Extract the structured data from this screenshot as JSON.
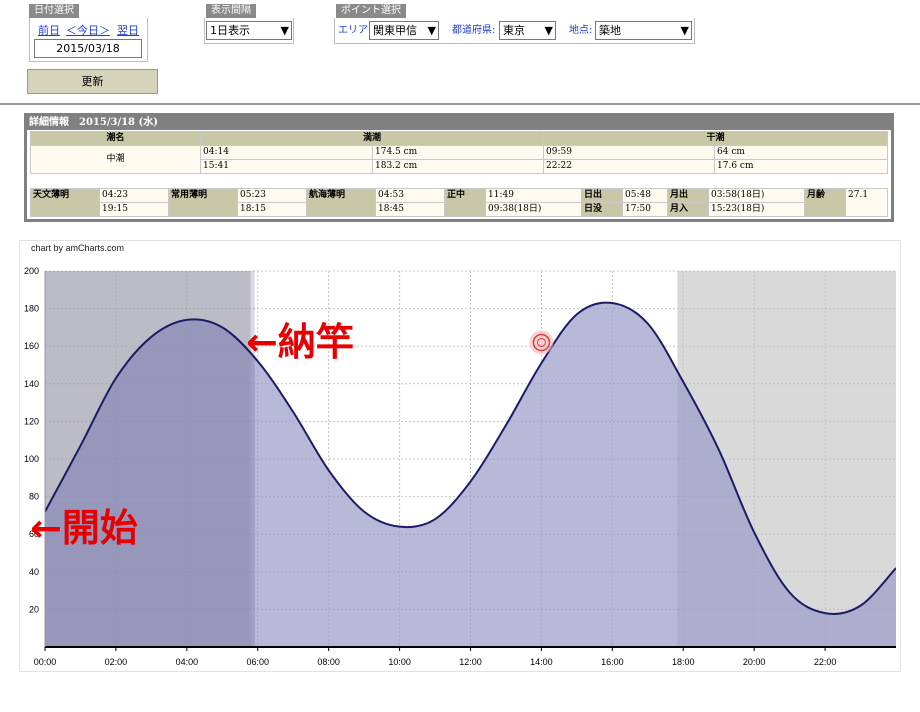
{
  "date_group": {
    "label": "日付選択",
    "prev": "前日",
    "today": "＜今日＞",
    "next": "翌日",
    "date": "2015/03/18",
    "update_button": "更新"
  },
  "interval_group": {
    "label": "表示間隔",
    "value": "1日表示"
  },
  "point_group": {
    "label": "ポイント選択",
    "area_label": "エリア:",
    "area_value": "関東甲信",
    "pref_label": "都道府県:",
    "pref_value": "東京",
    "site_label": "地点:",
    "site_value": "築地"
  },
  "detail": {
    "title": "詳細情報　2015/3/18 (水)",
    "headers": {
      "tide_name": "潮名",
      "high_tide": "満潮",
      "low_tide": "干潮"
    },
    "tide_name": "中潮",
    "high": [
      {
        "time": "04:14",
        "level": "174.5 cm"
      },
      {
        "time": "15:41",
        "level": "183.2 cm"
      }
    ],
    "low": [
      {
        "time": "09:59",
        "level": "64 cm"
      },
      {
        "time": "22:22",
        "level": "17.6 cm"
      }
    ],
    "twilight": {
      "astro_label": "天文薄明",
      "astro": [
        "04:23",
        "19:15"
      ],
      "civil_label": "常用薄明",
      "civil": [
        "05:23",
        "18:15"
      ],
      "nautical_label": "航海薄明",
      "nautical": [
        "04:53",
        "18:45"
      ],
      "noon_label": "正中",
      "noon": [
        "11:49",
        "09:38(18日)"
      ],
      "sunrise_label": "日出",
      "sunrise": "05:48",
      "sunset_label": "日没",
      "sunset": "17:50",
      "moonrise_label": "月出",
      "moonrise": "03:58(18日)",
      "moonset_label": "月入",
      "moonset": "15:23(18日)",
      "moonage_label": "月齢",
      "moonage": "27.1"
    }
  },
  "chart_credit": "chart by amCharts.com",
  "annotations": {
    "start": "←開始",
    "end": "←納竿"
  },
  "colors": {
    "line": "#1c1c66",
    "fill": "#9a9ac8",
    "night": "#d9d9d9",
    "accent": "#e60000"
  },
  "chart_data": {
    "type": "area",
    "xlabel": "",
    "ylabel": "",
    "x_ticks": [
      "00:00",
      "02:00",
      "04:00",
      "06:00",
      "08:00",
      "10:00",
      "12:00",
      "14:00",
      "16:00",
      "18:00",
      "20:00",
      "22:00"
    ],
    "y_ticks": [
      "20",
      "40",
      "60",
      "80",
      "100",
      "120",
      "140",
      "160",
      "180",
      "200"
    ],
    "ylim": [
      0,
      200
    ],
    "xlim_hours": [
      0,
      24
    ],
    "series": [
      {
        "values_hourly": [
          72,
          107,
          143,
          165,
          174,
          170,
          152,
          125,
          94,
          72,
          64,
          68,
          88,
          118,
          151,
          177,
          183,
          172,
          141,
          105,
          61,
          29,
          18,
          22,
          42
        ]
      }
    ],
    "extrema": [
      {
        "x": "04:14",
        "y": 174.5
      },
      {
        "x": "09:59",
        "y": 64
      },
      {
        "x": "15:41",
        "y": 183.2
      },
      {
        "x": "22:22",
        "y": 17.6
      }
    ],
    "night_bands": [
      [
        "00:00",
        "05:48"
      ],
      [
        "17:50",
        "24:00"
      ]
    ],
    "highlight_band": [
      "00:00",
      "05:55"
    ],
    "marker": {
      "x": "14:00",
      "y": 162
    },
    "grid": true
  }
}
